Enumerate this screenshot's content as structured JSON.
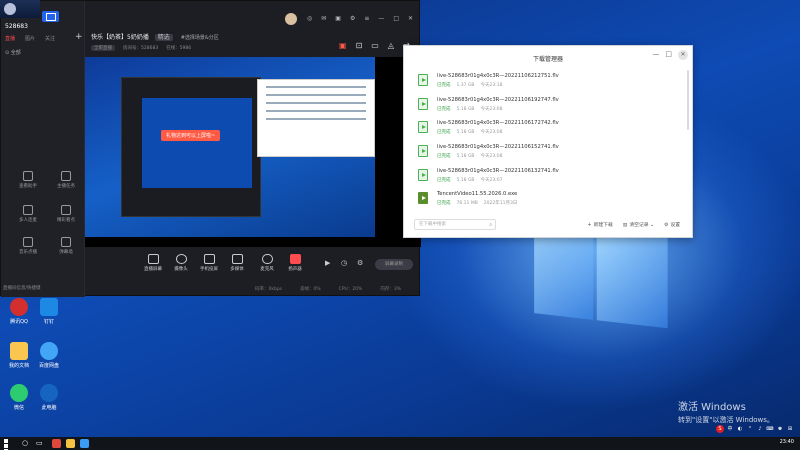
{
  "desktop": {
    "activate_line1": "激活 Windows",
    "activate_line2": "转到\"设置\"以激活 Windows。",
    "icons": [
      {
        "label": "腾讯QQ",
        "color": "#d32f2f"
      },
      {
        "label": "钉钉",
        "color": "#1e88e5"
      },
      {
        "label": "我的文档",
        "color": "#f9c74f"
      },
      {
        "label": "百度网盘",
        "color": "#42a5f5"
      },
      {
        "label": "微信",
        "color": "#2ecc71"
      },
      {
        "label": "此电脑",
        "color": "#1565c0"
      }
    ]
  },
  "live_app": {
    "stream_id": "528683",
    "left_tabs": [
      "直播",
      "图片",
      "关注"
    ],
    "all_label": "全部",
    "tools": [
      {
        "label": "查看助手"
      },
      {
        "label": "主播任务"
      },
      {
        "label": "多人连麦"
      },
      {
        "label": "精彩看点"
      },
      {
        "label": "音乐点播"
      },
      {
        "label": "弹幕墙"
      }
    ],
    "footer": "直播间信息/快捷键",
    "title": "快乐【奶茶】5奶奶播",
    "badge": "精选",
    "scene": "#选择场景&分区",
    "meta": [
      "房间号：528683",
      "在线：5986"
    ],
    "meta_pill": "全职直播",
    "bottom_buttons": [
      {
        "label": "直播屏幕"
      },
      {
        "label": "摄像头"
      },
      {
        "label": "手机投屏"
      },
      {
        "label": "多媒体"
      },
      {
        "label": "麦克风"
      },
      {
        "label": "扬声器"
      }
    ],
    "record_label": "屏幕录制",
    "status_items": [
      "码率：0kbps",
      "丢帧：0%",
      "CPU：20%",
      "内存：3%"
    ],
    "toast": "礼物达到可以上屏啦~"
  },
  "download_manager": {
    "title": "下载管理器",
    "items": [
      {
        "name": "live-528683r01g4x0c3R—20221106212751.flv",
        "status": "已完成",
        "size": "1.37 GB",
        "date": "今天23:18",
        "type": "video"
      },
      {
        "name": "live-528683r01g4x0c3R—20221106192747.flv",
        "status": "已完成",
        "size": "5.18 GB",
        "date": "今天23:08",
        "type": "video"
      },
      {
        "name": "live-528683r01g4x0c3R—20221106172742.flv",
        "status": "已完成",
        "size": "5.18 GB",
        "date": "今天23:08",
        "type": "video"
      },
      {
        "name": "live-528683r01g4x0c3R—20221106152741.flv",
        "status": "已完成",
        "size": "5.18 GB",
        "date": "今天23:08",
        "type": "video"
      },
      {
        "name": "live-528683r01g4x0c3R—20221106132741.flv",
        "status": "已完成",
        "size": "5.18 GB",
        "date": "今天23:07",
        "type": "video"
      },
      {
        "name": "TencentVideo11.55.2026.0.exe",
        "status": "已完成",
        "size": "76.11 MB",
        "date": "2022年11月3日",
        "type": "exe"
      }
    ],
    "search_placeholder": "在下载中搜索",
    "actions": [
      "新建下载",
      "清空记录",
      "设置"
    ]
  },
  "taskbar": {
    "clock": "23:40"
  }
}
